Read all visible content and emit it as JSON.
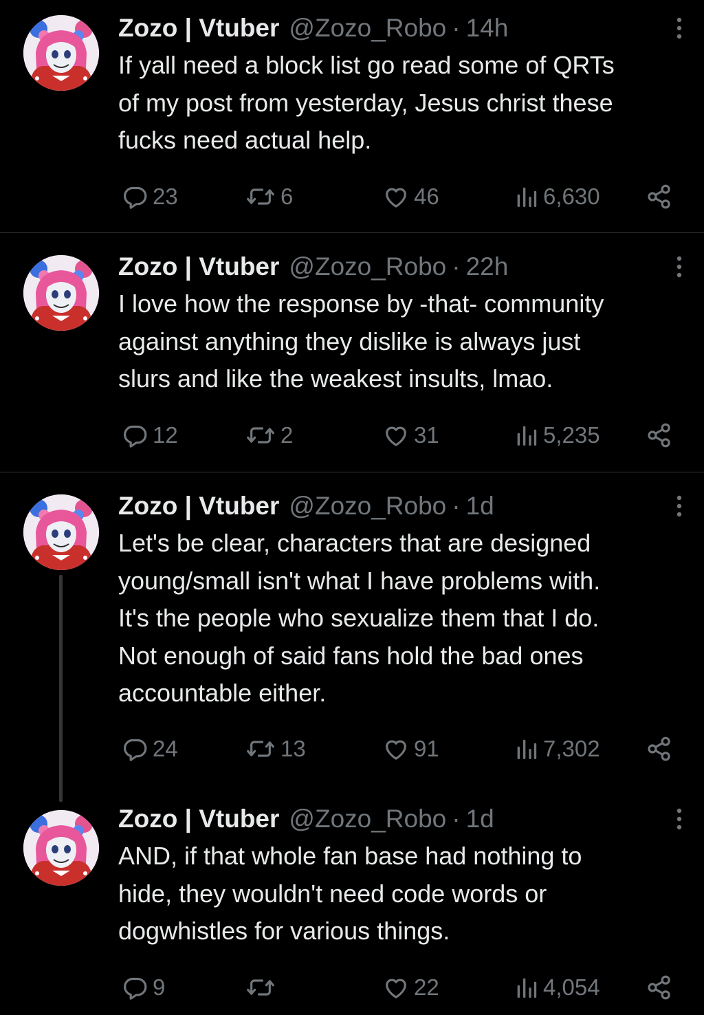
{
  "tweets": [
    {
      "name": "Zozo | Vtuber",
      "handle": "@Zozo_Robo",
      "time": "14h",
      "text": "If yall need a block list go read some of QRTs\nof my post from yesterday, Jesus christ these\nfucks need actual help.",
      "replies": "23",
      "reposts": "6",
      "likes": "46",
      "views": "6,630"
    },
    {
      "name": "Zozo | Vtuber",
      "handle": "@Zozo_Robo",
      "time": "22h",
      "text": "I love how the response by -that- community\nagainst anything they dislike is always just\nslurs and like the weakest insults, lmao.",
      "replies": "12",
      "reposts": "2",
      "likes": "31",
      "views": "5,235"
    },
    {
      "name": "Zozo | Vtuber",
      "handle": "@Zozo_Robo",
      "time": "1d",
      "text": "Let's be clear, characters that are designed\nyoung/small isn't what I have problems with.\nIt's the people who sexualize them that I do.\nNot enough of said fans hold the bad ones\naccountable either.",
      "replies": "24",
      "reposts": "13",
      "likes": "91",
      "views": "7,302"
    },
    {
      "name": "Zozo | Vtuber",
      "handle": "@Zozo_Robo",
      "time": "1d",
      "text": "AND, if that whole fan base had nothing to\nhide, they wouldn't need code words or\ndogwhistles for various things.",
      "replies": "9",
      "reposts": "",
      "likes": "22",
      "views": "4,054"
    }
  ],
  "separator": "·",
  "icons": {
    "avatar": "vtuber-avatar-icon",
    "more": "more-vertical-icon",
    "reply": "reply-icon",
    "repost": "repost-icon",
    "like": "heart-icon",
    "views": "views-chart-icon",
    "share": "share-icon"
  },
  "colors": {
    "background": "#000000",
    "text": "#e7e9ea",
    "muted": "#71767b",
    "divider": "#2f3336"
  }
}
